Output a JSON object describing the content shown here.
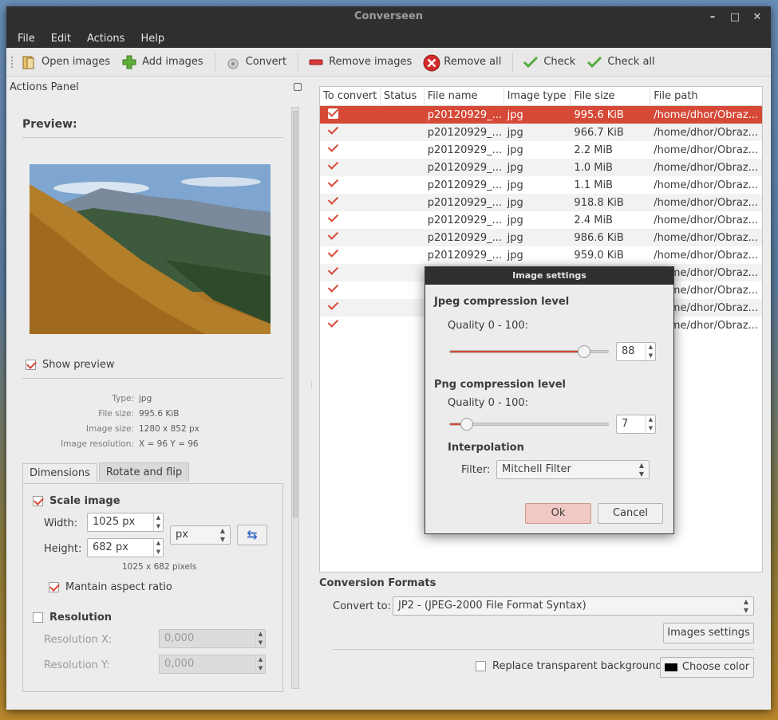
{
  "window": {
    "title": "Converseen"
  },
  "menu": [
    "File",
    "Edit",
    "Actions",
    "Help"
  ],
  "toolbar": {
    "open_images": "Open images",
    "add_images": "Add images",
    "convert": "Convert",
    "remove_images": "Remove images",
    "remove_all": "Remove all",
    "check": "Check",
    "check_all": "Check all"
  },
  "actions_panel": {
    "title": "Actions Panel",
    "preview_heading": "Preview:",
    "show_preview": "Show preview",
    "info": {
      "type_label": "Type:",
      "type_value": "jpg",
      "file_size_label": "File size:",
      "file_size_value": "995.6 KiB",
      "image_size_label": "Image size:",
      "image_size_value": "1280 x 852 px",
      "resolution_label": "Image resolution:",
      "resolution_value": "X = 96 Y = 96"
    },
    "tabs": [
      "Dimensions",
      "Rotate and flip"
    ],
    "scale_image": "Scale image",
    "width_label": "Width:",
    "width_value": "1025 px",
    "height_label": "Height:",
    "height_value": "682 px",
    "unit": "px",
    "pixels_note": "1025 x 682 pixels",
    "maintain_aspect": "Mantain aspect ratio",
    "resolution": "Resolution",
    "res_x_label": "Resolution X:",
    "res_x_value": "0,000",
    "res_y_label": "Resolution Y:",
    "res_y_value": "0,000"
  },
  "table": {
    "columns": [
      "To convert",
      "Status",
      "File name",
      "Image type",
      "File size",
      "File path"
    ],
    "rows": [
      {
        "name": "p20120929_...",
        "type": "jpg",
        "size": "995.6 KiB",
        "path": "/home/dhor/Obraz..."
      },
      {
        "name": "p20120929_...",
        "type": "jpg",
        "size": "966.7 KiB",
        "path": "/home/dhor/Obraz..."
      },
      {
        "name": "p20120929_...",
        "type": "jpg",
        "size": "2.2 MiB",
        "path": "/home/dhor/Obraz..."
      },
      {
        "name": "p20120929_...",
        "type": "jpg",
        "size": "1.0 MiB",
        "path": "/home/dhor/Obraz..."
      },
      {
        "name": "p20120929_...",
        "type": "jpg",
        "size": "1.1 MiB",
        "path": "/home/dhor/Obraz..."
      },
      {
        "name": "p20120929_...",
        "type": "jpg",
        "size": "918.8 KiB",
        "path": "/home/dhor/Obraz..."
      },
      {
        "name": "p20120929_...",
        "type": "jpg",
        "size": "2.4 MiB",
        "path": "/home/dhor/Obraz..."
      },
      {
        "name": "p20120929_...",
        "type": "jpg",
        "size": "986.6 KiB",
        "path": "/home/dhor/Obraz..."
      },
      {
        "name": "p20120929_...",
        "type": "jpg",
        "size": "959.0 KiB",
        "path": "/home/dhor/Obraz..."
      },
      {
        "name": "",
        "type": "",
        "size": "",
        "path": "/home/dhor/Obraz..."
      },
      {
        "name": "",
        "type": "",
        "size": "",
        "path": "/home/dhor/Obraz..."
      },
      {
        "name": "",
        "type": "",
        "size": "",
        "path": "/home/dhor/Obraz..."
      },
      {
        "name": "",
        "type": "",
        "size": "",
        "path": "/home/dhor/Obraz..."
      }
    ]
  },
  "conversion": {
    "title": "Conversion Formats",
    "convert_to_label": "Convert to:",
    "convert_to_value": "JP2 - (JPEG-2000 File Format Syntax)",
    "images_settings": "Images settings",
    "replace_bg": "Replace transparent background",
    "choose_color": "Choose color"
  },
  "dialog": {
    "title": "Image settings",
    "jpeg_heading": "Jpeg compression level",
    "jpeg_quality_label": "Quality 0 - 100:",
    "jpeg_quality_value": "88",
    "jpeg_level": 0.88,
    "png_heading": "Png compression level",
    "png_quality_label": "Quality 0 - 100:",
    "png_quality_value": "7",
    "png_level": 0.07,
    "interpolation": "Interpolation",
    "filter_label": "Filter:",
    "filter_value": "Mitchell Filter",
    "ok": "Ok",
    "cancel": "Cancel"
  },
  "colors": {
    "accent": "#d64937",
    "titlebar": "#2f2f2f",
    "window": "#ececec"
  }
}
